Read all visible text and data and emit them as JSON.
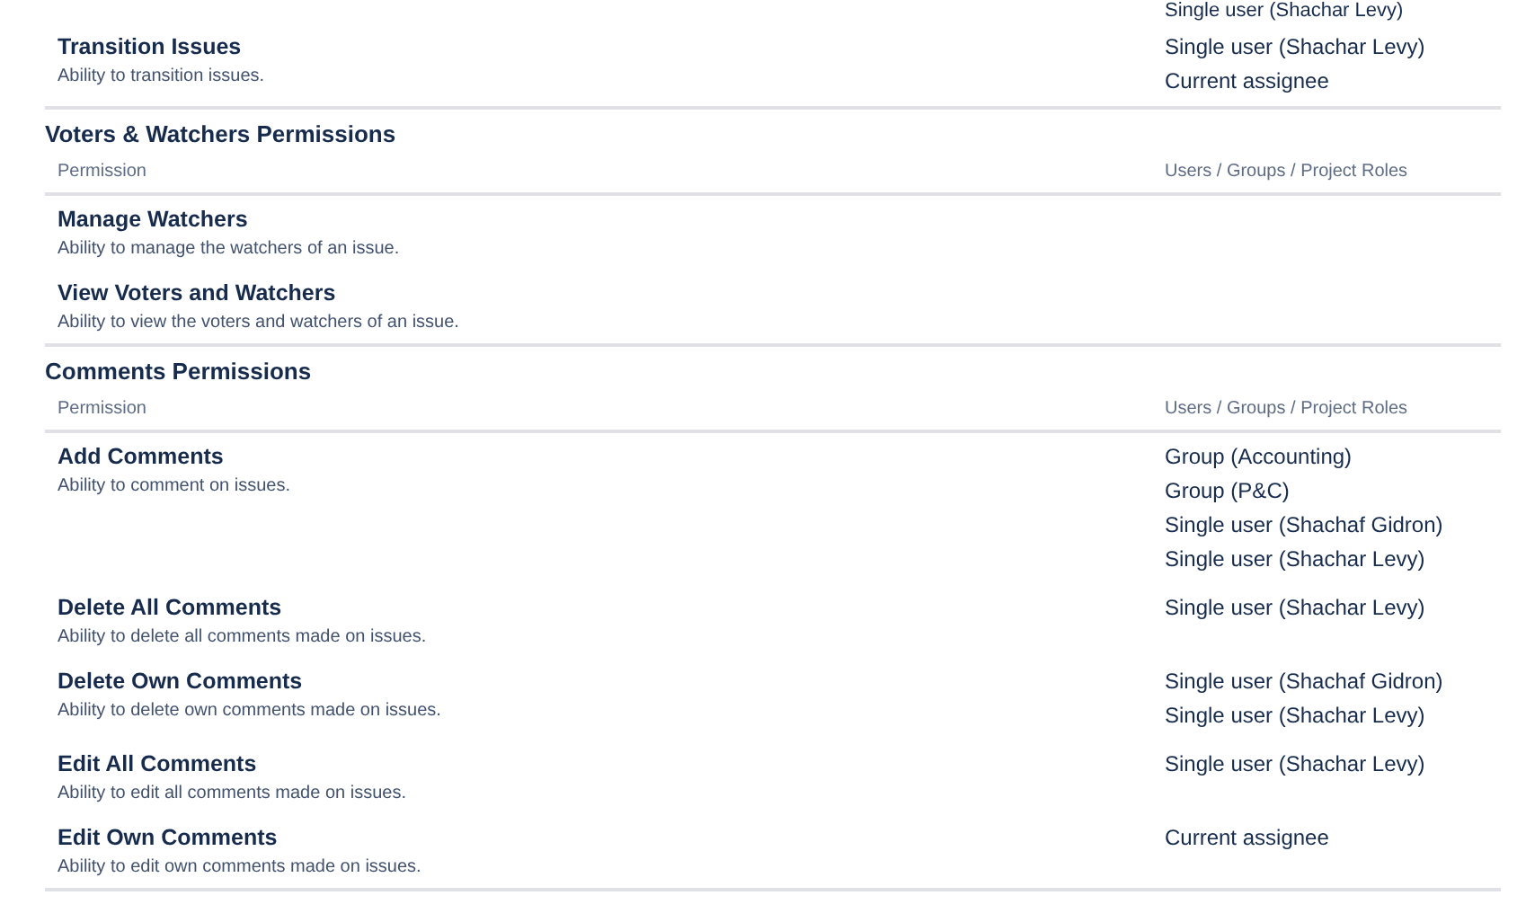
{
  "leading_grants": [
    "Single user (Shachar Levy)"
  ],
  "sections": [
    {
      "rows": [
        {
          "name": "Transition Issues",
          "description": "Ability to transition issues.",
          "grants": [
            "Single user (Shachar Levy)",
            "Current assignee"
          ]
        }
      ]
    },
    {
      "title": "Voters & Watchers Permissions",
      "columns": [
        "Permission",
        "Users / Groups / Project Roles"
      ],
      "rows": [
        {
          "name": "Manage Watchers",
          "description": "Ability to manage the watchers of an issue.",
          "grants": []
        },
        {
          "name": "View Voters and Watchers",
          "description": "Ability to view the voters and watchers of an issue.",
          "grants": []
        }
      ]
    },
    {
      "title": "Comments Permissions",
      "columns": [
        "Permission",
        "Users / Groups / Project Roles"
      ],
      "rows": [
        {
          "name": "Add Comments",
          "description": "Ability to comment on issues.",
          "grants": [
            "Group (Accounting)",
            "Group (P&C)",
            "Single user (Shachaf Gidron)",
            "Single user (Shachar Levy)"
          ]
        },
        {
          "name": "Delete All Comments",
          "description": "Ability to delete all comments made on issues.",
          "grants": [
            "Single user (Shachar Levy)"
          ]
        },
        {
          "name": "Delete Own Comments",
          "description": "Ability to delete own comments made on issues.",
          "grants": [
            "Single user (Shachaf Gidron)",
            "Single user (Shachar Levy)"
          ]
        },
        {
          "name": "Edit All Comments",
          "description": "Ability to edit all comments made on issues.",
          "grants": [
            "Single user (Shachar Levy)"
          ]
        },
        {
          "name": "Edit Own Comments",
          "description": "Ability to edit own comments made on issues.",
          "grants": [
            "Current assignee"
          ]
        }
      ]
    }
  ]
}
